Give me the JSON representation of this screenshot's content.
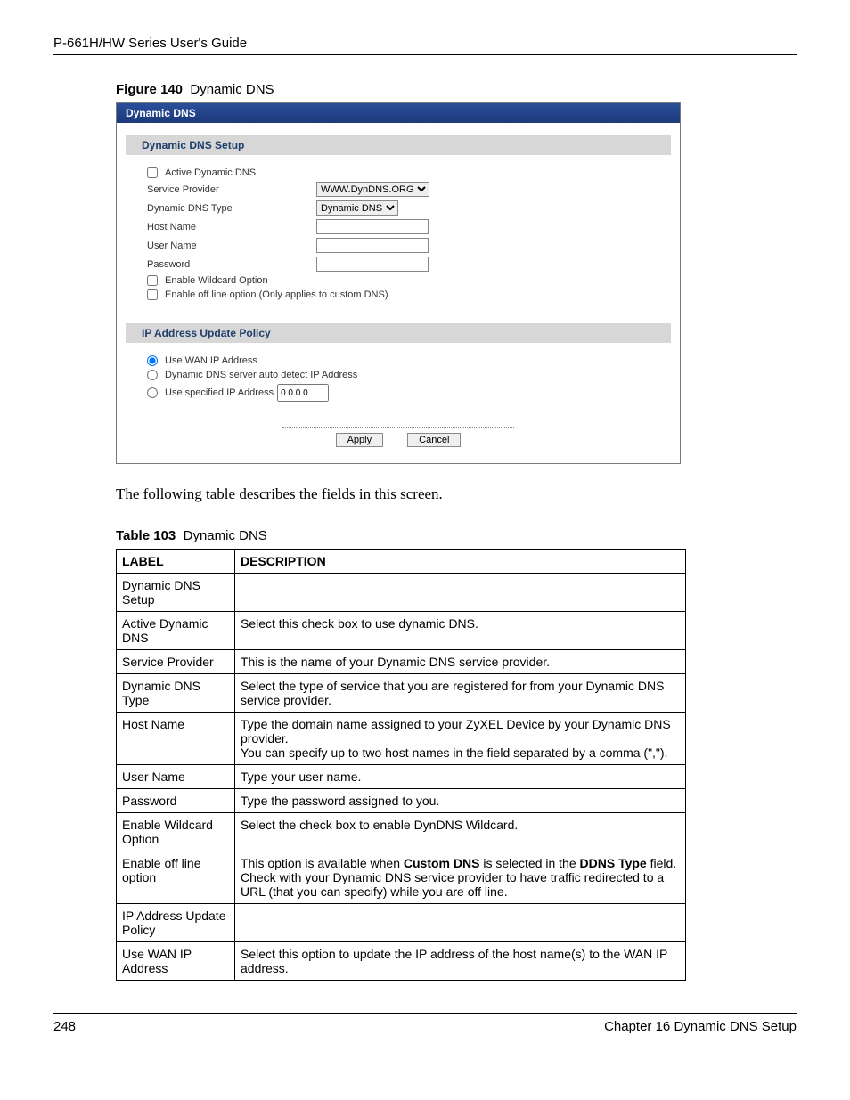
{
  "header": {
    "title": "P-661H/HW Series User's Guide"
  },
  "figure": {
    "label": "Figure 140",
    "title": "Dynamic DNS"
  },
  "panel": {
    "title": "Dynamic DNS",
    "section1": "Dynamic DNS Setup",
    "activeDDNS": "Active Dynamic DNS",
    "serviceProvider": {
      "label": "Service Provider",
      "value": "WWW.DynDNS.ORG"
    },
    "ddnsType": {
      "label": "Dynamic DNS Type",
      "value": "Dynamic DNS"
    },
    "hostName": {
      "label": "Host Name",
      "value": ""
    },
    "userName": {
      "label": "User Name",
      "value": ""
    },
    "password": {
      "label": "Password",
      "value": ""
    },
    "enableWildcard": "Enable Wildcard Option",
    "enableOffline": "Enable off line option (Only applies to custom DNS)",
    "section2": "IP Address Update Policy",
    "useWan": "Use WAN IP Address",
    "autoDetect": "Dynamic DNS server auto detect IP Address",
    "useSpecified": "Use specified IP Address",
    "specifiedIP": "0.0.0.0",
    "applyBtn": "Apply",
    "cancelBtn": "Cancel"
  },
  "bodyText": "The following table describes the fields in this screen.",
  "tableCaption": {
    "label": "Table 103",
    "title": "Dynamic DNS"
  },
  "tableHeaders": {
    "c1": "LABEL",
    "c2": "DESCRIPTION"
  },
  "rows": [
    {
      "label": "Dynamic DNS Setup",
      "desc": ""
    },
    {
      "label": "Active Dynamic DNS",
      "desc": "Select this check box to use dynamic DNS."
    },
    {
      "label": "Service Provider",
      "desc": "This is the name of your Dynamic DNS service provider."
    },
    {
      "label": "Dynamic DNS Type",
      "desc": "Select the type of service that you are registered for from your Dynamic DNS service provider."
    },
    {
      "label": "Host Name",
      "desc": "Type the domain name assigned to your ZyXEL Device by your Dynamic DNS provider.\nYou can specify up to two host names in the field separated by a comma (\",\")."
    },
    {
      "label": "User Name",
      "desc": "Type your user name."
    },
    {
      "label": "Password",
      "desc": "Type the password assigned to you."
    },
    {
      "label": "Enable Wildcard Option",
      "desc": "Select the check box to enable DynDNS Wildcard."
    },
    {
      "label": "Enable off line option",
      "desc_html": "This option is available when <b>Custom DNS</b> is selected in the <b>DDNS Type</b> field. Check with your Dynamic DNS service provider to have traffic redirected to a URL (that you can specify) while you are off line."
    },
    {
      "label": "IP Address Update Policy",
      "desc": ""
    },
    {
      "label": "Use WAN IP Address",
      "desc": "Select this option to update the IP address of the host name(s) to the WAN IP address."
    }
  ],
  "footer": {
    "page": "248",
    "chapter": "Chapter 16 Dynamic DNS Setup"
  }
}
